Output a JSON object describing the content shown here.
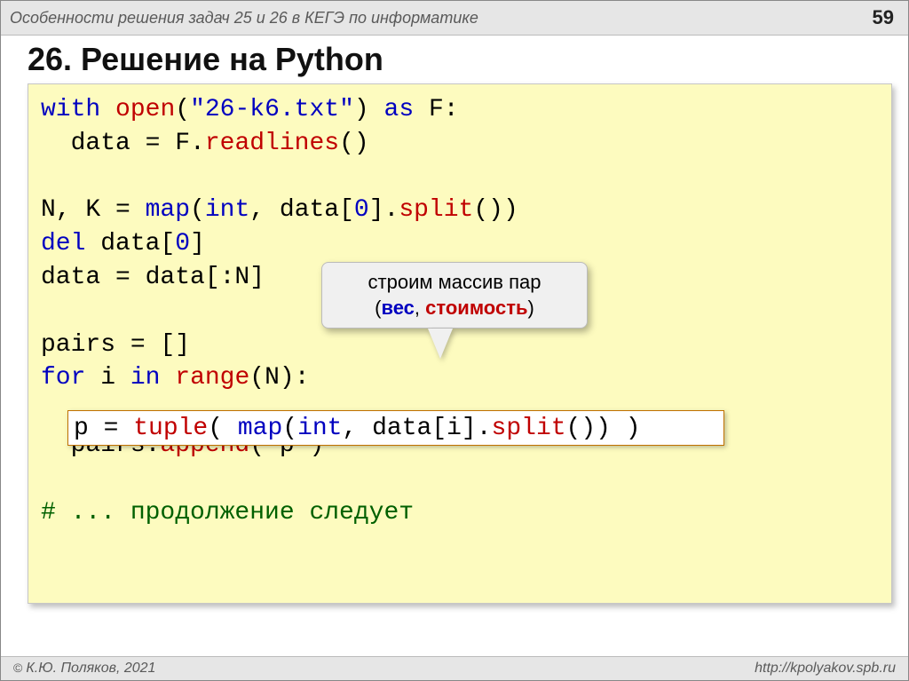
{
  "header": {
    "title": "Особенности решения задач 25 и 26 в КЕГЭ по информатике",
    "page_number": "59"
  },
  "heading": "26. Решение на Python",
  "code": {
    "l01_with": "with",
    "l01_open": "open",
    "l01_paren": "(",
    "l01_str": "\"26-k6.txt\"",
    "l01_cparen": ")",
    "l01_as": "as",
    "l01_F": "F:",
    "l02_a": "  data = F.",
    "l02_read": "readlines",
    "l02_b": "()",
    "l04_a": "N, K = ",
    "l04_map": "map",
    "l04_b": "(",
    "l04_int": "int",
    "l04_c": ", data[",
    "l04_zero": "0",
    "l04_d": "].",
    "l04_split": "split",
    "l04_e": "())",
    "l05_del": "del",
    "l05_a": " data[",
    "l05_zero": "0",
    "l05_b": "]",
    "l06": "data = data[:N]",
    "l08": "pairs = []",
    "l09_for": "for",
    "l09_a": " i ",
    "l09_in": "in",
    "l09_b": " ",
    "l09_range": "range",
    "l09_c": "(N):",
    "l10_a": "p = ",
    "l10_tuple": "tuple",
    "l10_b": "( ",
    "l10_map": "map",
    "l10_c": "(",
    "l10_int": "int",
    "l10_d": ", data[i].",
    "l10_split": "split",
    "l10_e": "()) )",
    "l11_a": "  pairs.",
    "l11_append": "append",
    "l11_b": "( p )",
    "l13_comment": "# ... продолжение следует"
  },
  "callout": {
    "line1": "строим массив пар",
    "paren_open": "(",
    "weight": "вес",
    "comma": ", ",
    "cost": "стоимость",
    "paren_close": ")"
  },
  "footer": {
    "copyright_mark": "©",
    "copyright": "К.Ю. Поляков, 2021",
    "url": "http://kpolyakov.spb.ru"
  }
}
